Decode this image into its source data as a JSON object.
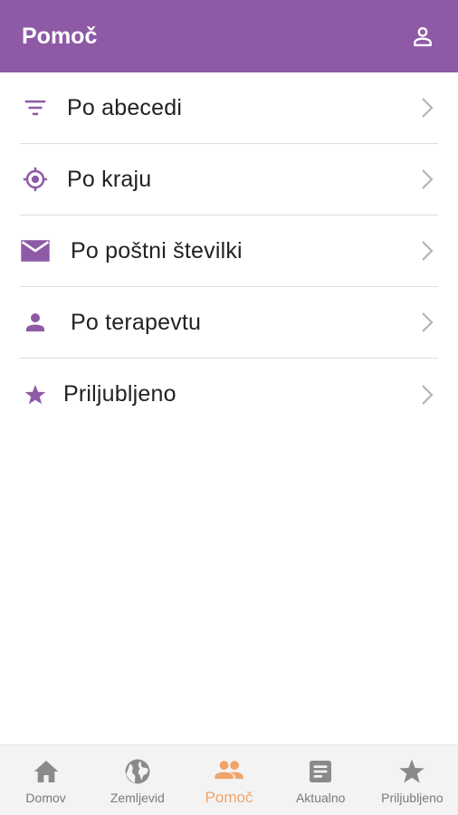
{
  "appbar": {
    "title": "Pomoč",
    "profile_icon": "person-outline-icon",
    "background": "#8e5aa6"
  },
  "menu": {
    "accent": "#8e5aa6",
    "items": [
      {
        "label": "Po abecedi",
        "icon": "filter-icon"
      },
      {
        "label": "Po kraju",
        "icon": "location-target-icon"
      },
      {
        "label": "Po poštni številki",
        "icon": "mail-icon"
      },
      {
        "label": "Po terapevtu",
        "icon": "person-icon"
      },
      {
        "label": "Priljubljeno",
        "icon": "star-icon"
      }
    ]
  },
  "bottom_nav": {
    "active_color": "#f0a46a",
    "inactive_color": "#7a7a7a",
    "items": [
      {
        "label": "Domov",
        "icon": "home-icon",
        "active": false
      },
      {
        "label": "Zemljevid",
        "icon": "globe-icon",
        "active": false
      },
      {
        "label": "Pomoč",
        "icon": "people-icon",
        "active": true
      },
      {
        "label": "Aktualno",
        "icon": "article-icon",
        "active": false
      },
      {
        "label": "Priljubljeno",
        "icon": "star-icon",
        "active": false
      }
    ]
  }
}
